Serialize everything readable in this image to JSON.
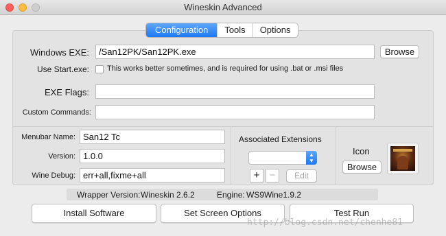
{
  "window": {
    "title": "Wineskin Advanced"
  },
  "tabs": [
    {
      "label": "Configuration",
      "active": true
    },
    {
      "label": "Tools",
      "active": false
    },
    {
      "label": "Options",
      "active": false
    }
  ],
  "config": {
    "windows_exe_label": "Windows EXE:",
    "windows_exe_value": "/San12PK/San12PK.exe",
    "browse_label": "Browse",
    "use_start_label": "Use Start.exe:",
    "use_start_checked": false,
    "use_start_desc": "This works better sometimes, and is required for using .bat or .msi files",
    "exe_flags_label": "EXE Flags:",
    "exe_flags_value": "",
    "custom_commands_label": "Custom Commands:",
    "custom_commands_value": ""
  },
  "details": {
    "menubar_name_label": "Menubar Name:",
    "menubar_name_value": "San12 Tc",
    "version_label": "Version:",
    "version_value": "1.0.0",
    "wine_debug_label": "Wine Debug:",
    "wine_debug_value": "err+all,fixme+all"
  },
  "extensions": {
    "title": "Associated Extensions",
    "selected": "",
    "add": "+",
    "remove": "−",
    "edit": "Edit"
  },
  "icon_section": {
    "label": "Icon",
    "browse_label": "Browse"
  },
  "status": {
    "wrapper_label": "Wrapper Version:",
    "wrapper_value": "Wineskin 2.6.2",
    "engine_label": "Engine:",
    "engine_value": "WS9Wine1.9.2"
  },
  "actions": {
    "install_software": "Install Software",
    "set_screen_options": "Set Screen Options",
    "test_run": "Test Run"
  },
  "watermark": "http://blog.csdn.net/chenhe81",
  "colors": {
    "accent": "#1b78f2",
    "close": "#fc605c",
    "minimize": "#fdbc40"
  }
}
